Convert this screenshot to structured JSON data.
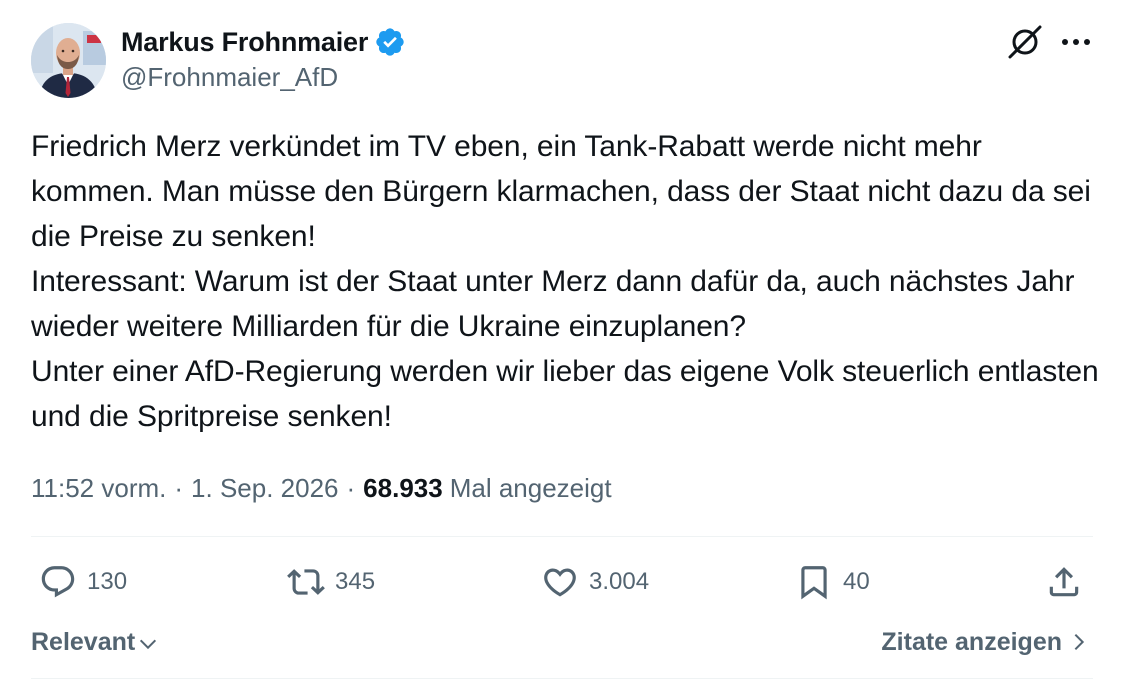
{
  "author": {
    "display_name": "Markus Frohnmaier",
    "handle": "@Frohnmaier_AfD",
    "verified": true
  },
  "tweet": {
    "text": "Friedrich Merz verkündet im TV eben, ein Tank-Rabatt werde nicht mehr kommen. Man müsse den Bürgern klarmachen, dass der Staat nicht dazu da sei die Preise zu senken!\nInteressant: Warum ist der Staat unter Merz dann dafür da, auch nächstes Jahr wieder weitere Milliarden für die Ukraine einzuplanen?\nUnter einer AfD-Regierung werden wir lieber das eigene Volk steuerlich entlasten und die Spritpreise senken!",
    "time": "11:52 vorm.",
    "separator": "·",
    "date": "1. Sep. 2026",
    "views_count": "68.933",
    "views_label": "Mal angezeigt"
  },
  "actions": {
    "replies": "130",
    "retweets": "345",
    "likes": "3.004",
    "bookmarks": "40"
  },
  "footer": {
    "sort_label": "Relevant",
    "quotes_label": "Zitate anzeigen"
  },
  "icons": {
    "verified": "verified-badge-icon",
    "grok": "grok-icon",
    "more": "more-icon",
    "reply": "reply-icon",
    "retweet": "retweet-icon",
    "like": "heart-icon",
    "bookmark": "bookmark-icon",
    "share": "share-icon"
  },
  "colors": {
    "verified_blue": "#1d9bf0",
    "text_primary": "#0f1419",
    "text_secondary": "#536471",
    "divider": "#eff3f4"
  }
}
